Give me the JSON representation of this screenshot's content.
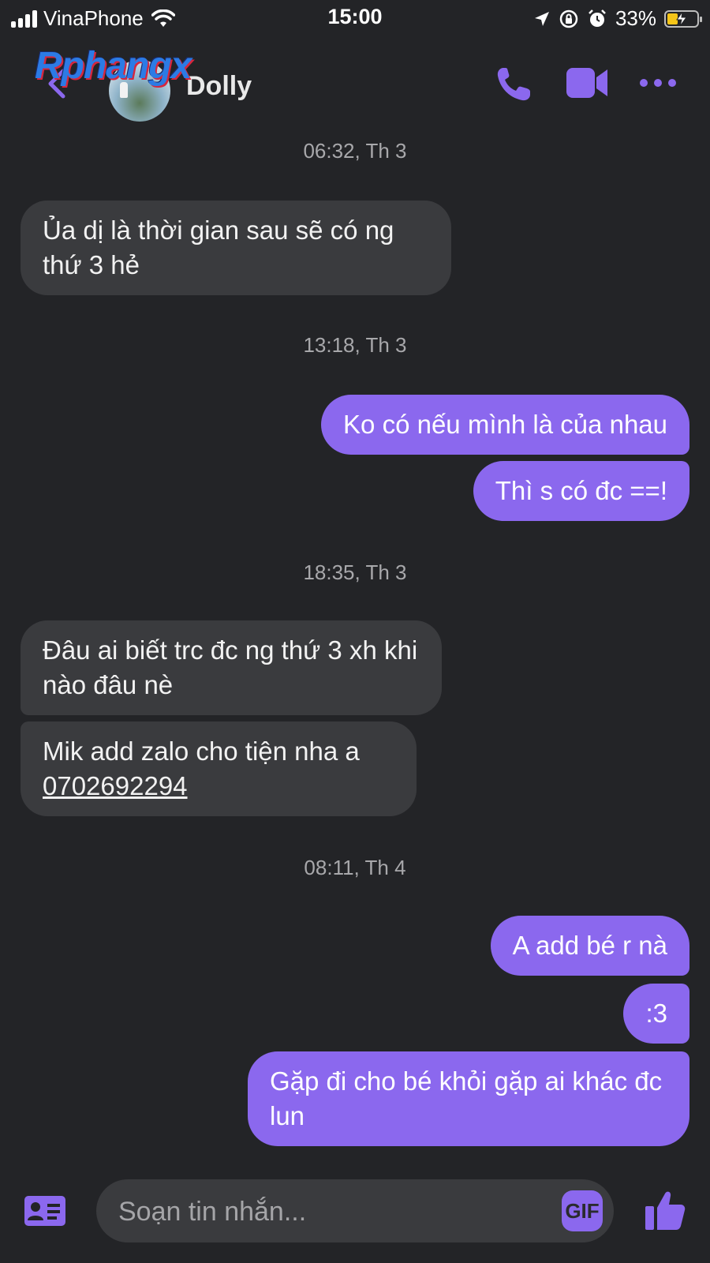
{
  "status_bar": {
    "carrier": "VinaPhone",
    "time": "15:00",
    "battery_percent": "33%",
    "battery_level": 0.33,
    "icons": [
      "signal-icon",
      "wifi-icon",
      "location-icon",
      "orientation-lock-icon",
      "alarm-icon",
      "battery-charging-icon"
    ]
  },
  "header": {
    "logo_text": "Rphangx",
    "contact_name": "Dolly",
    "icons": [
      "back-icon",
      "phone-icon",
      "video-call-icon",
      "more-icon"
    ],
    "accent": "#8b68ee"
  },
  "messages": [
    {
      "type": "timestamp",
      "text": "06:32, Th 3"
    },
    {
      "type": "incoming",
      "text": "Ủa dị là thời gian sau sẽ có ng thứ 3 hẻ"
    },
    {
      "type": "timestamp",
      "text": "13:18, Th 3"
    },
    {
      "type": "outgoing",
      "text": "Ko có nếu mình là của nhau"
    },
    {
      "type": "outgoing",
      "text": "Thì s có đc ==!"
    },
    {
      "type": "timestamp",
      "text": "18:35, Th 3"
    },
    {
      "type": "incoming",
      "text": "Đâu ai biết trc đc ng thứ 3 xh khi nào đâu nè"
    },
    {
      "type": "incoming",
      "text": "Mik add zalo cho tiện nha a",
      "link": "0702692294"
    },
    {
      "type": "timestamp",
      "text": "08:11, Th 4"
    },
    {
      "type": "outgoing",
      "text": "A add bé r nà"
    },
    {
      "type": "outgoing",
      "text": ":3"
    },
    {
      "type": "outgoing",
      "text": "Gặp đi cho bé khỏi gặp ai khác đc lun"
    }
  ],
  "composer": {
    "placeholder": "Soạn tin nhắn...",
    "gif_label": "GIF",
    "icons": [
      "contact-card-icon",
      "like-icon"
    ]
  },
  "colors": {
    "background": "#232427",
    "incoming_bubble": "#3a3b3e",
    "outgoing_bubble": "#8b68ee"
  }
}
